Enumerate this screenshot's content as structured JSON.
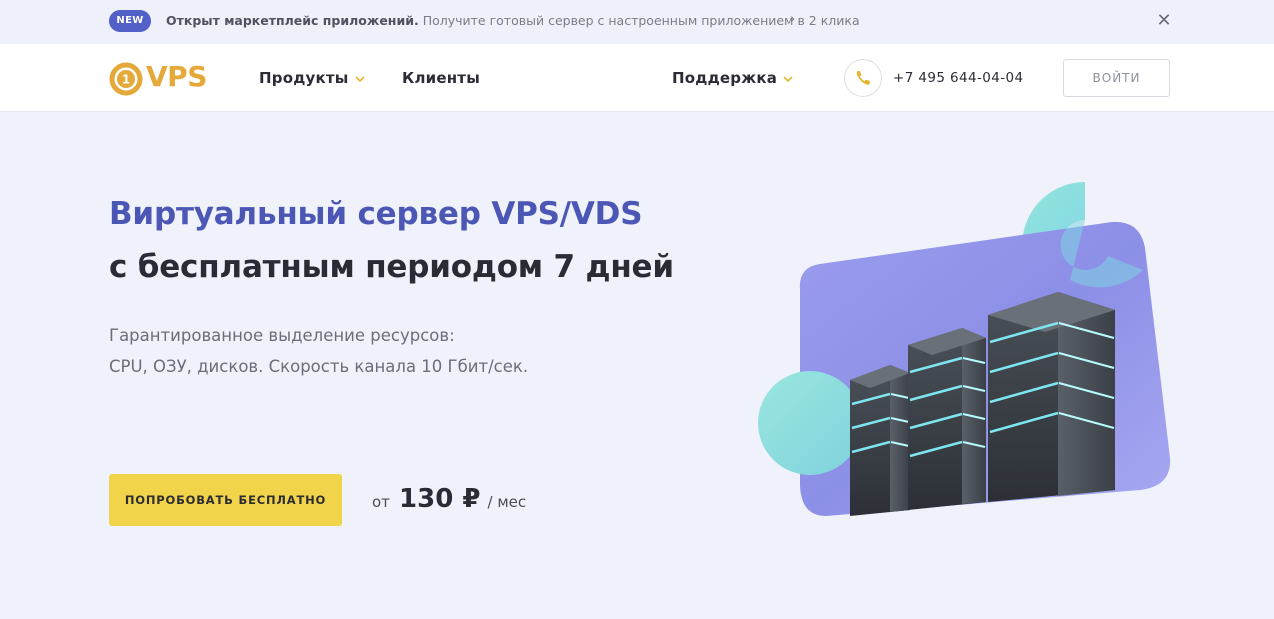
{
  "announcement": {
    "badge": "NEW",
    "title": "Открыт маркетплейс приложений.",
    "text": "Получите готовый сервер с настроенным приложением в 2 клика",
    "chevron": "›",
    "close": "✕"
  },
  "header": {
    "logo_text": "VPS",
    "logo_digit": "1",
    "nav": [
      {
        "label": "Продукты",
        "has_dropdown": true
      },
      {
        "label": "Клиенты",
        "has_dropdown": false
      },
      {
        "label": "Поддержка",
        "has_dropdown": true
      }
    ],
    "dropdown_icon": "chevron-down-icon",
    "phone_icon": "phone-icon",
    "phone": "+7 495 644-04-04",
    "login_label": "ВОЙТИ"
  },
  "hero": {
    "title_line1": "Виртуальный сервер VPS/VDS",
    "title_line2": "с бесплатным периодом 7 дней",
    "subtitle_line1": "Гарантированное выделение ресурсов:",
    "subtitle_line2": "CPU, ОЗУ, дисков. Скорость канала 10 Гбит/сек.",
    "cta_label": "ПОПРОБОВАТЬ БЕСПЛАТНО",
    "price_prefix": "от",
    "price_value": "130 ₽",
    "price_suffix": "/ мес"
  },
  "colors": {
    "accent_blue": "#4b56b5",
    "badge": "#5260c8",
    "cta_yellow": "#f2d44a",
    "logo_orange": "#e5a93a",
    "illustration_purple": "#8c8fe6",
    "illustration_teal": "#7fd9dc"
  }
}
